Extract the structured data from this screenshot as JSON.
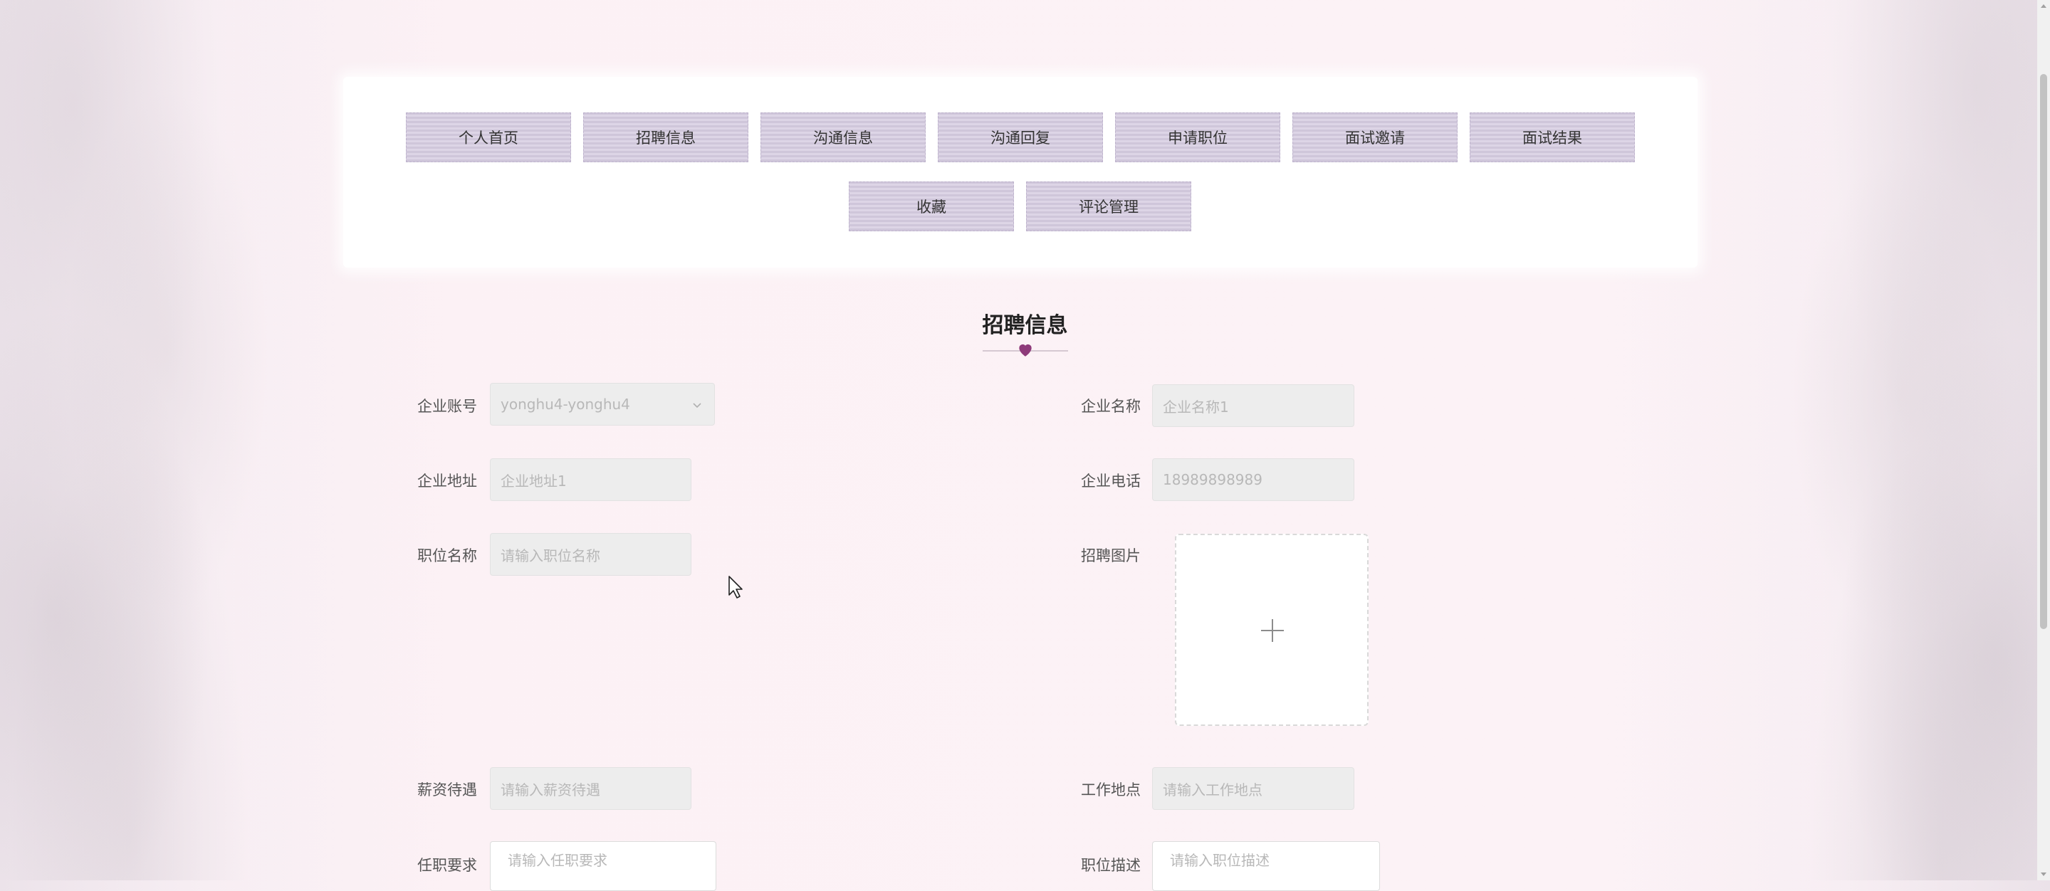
{
  "nav": {
    "items": [
      "个人首页",
      "招聘信息",
      "沟通信息",
      "沟通回复",
      "申请职位",
      "面试邀请",
      "面试结果",
      "收藏",
      "评论管理"
    ]
  },
  "page": {
    "title": "招聘信息",
    "accent_color": "#8e3a7a"
  },
  "form": {
    "company_account": {
      "label": "企业账号",
      "value": "yonghu4-yonghu4"
    },
    "company_name": {
      "label": "企业名称",
      "placeholder": "企业名称1"
    },
    "company_address": {
      "label": "企业地址",
      "placeholder": "企业地址1"
    },
    "company_phone": {
      "label": "企业电话",
      "placeholder": "18989898989"
    },
    "position_name": {
      "label": "职位名称",
      "placeholder": "请输入职位名称"
    },
    "recruit_image": {
      "label": "招聘图片",
      "icon": "plus-icon"
    },
    "salary": {
      "label": "薪资待遇",
      "placeholder": "请输入薪资待遇"
    },
    "work_location": {
      "label": "工作地点",
      "placeholder": "请输入工作地点"
    },
    "requirements": {
      "label": "任职要求",
      "placeholder": "请输入任职要求"
    },
    "job_description": {
      "label": "职位描述",
      "placeholder": "请输入职位描述"
    }
  }
}
